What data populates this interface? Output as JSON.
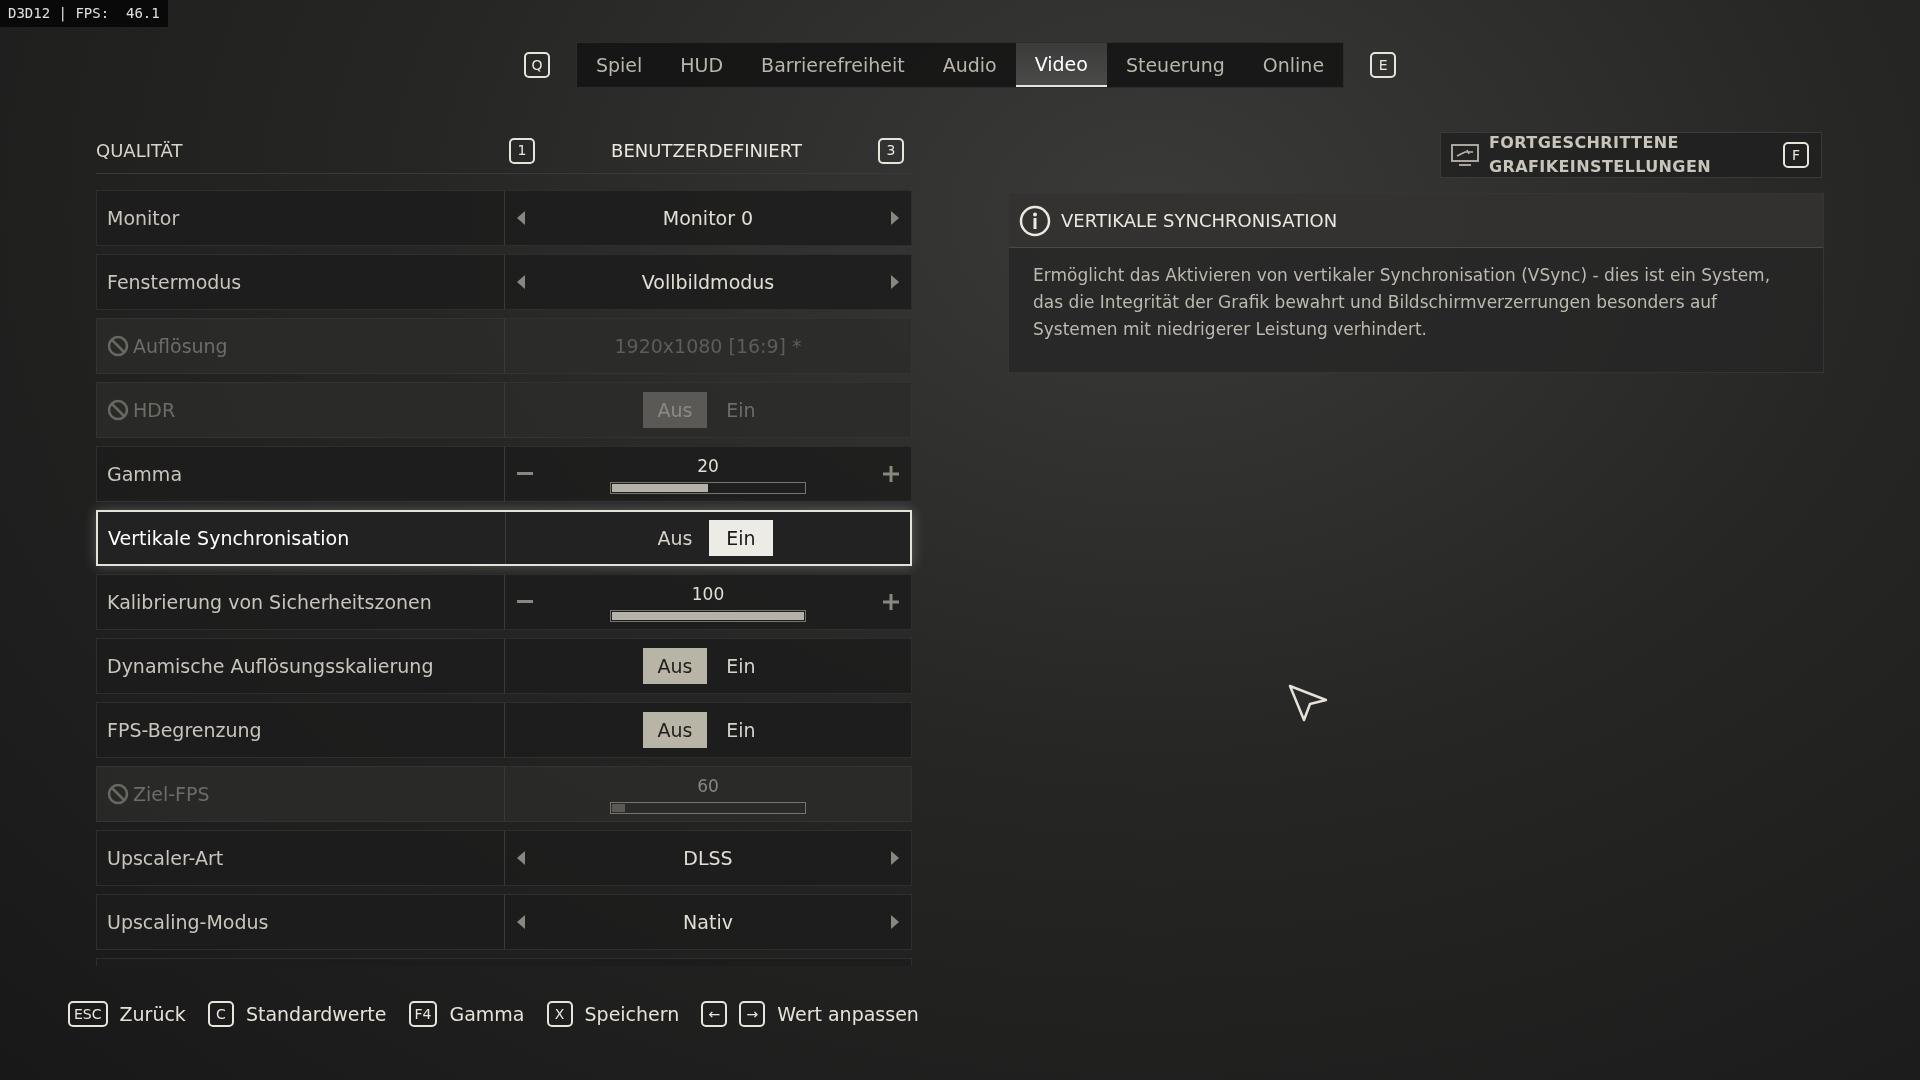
{
  "debug_overlay": "D3D12 | FPS:  46.1",
  "tab_bar": {
    "prev_key": "Q",
    "next_key": "E",
    "tabs": [
      {
        "label": "Spiel",
        "selected": false
      },
      {
        "label": "HUD",
        "selected": false
      },
      {
        "label": "Barrierefreiheit",
        "selected": false
      },
      {
        "label": "Audio",
        "selected": false
      },
      {
        "label": "Video",
        "selected": true
      },
      {
        "label": "Steuerung",
        "selected": false
      },
      {
        "label": "Online",
        "selected": false
      }
    ]
  },
  "quality": {
    "label": "QUALITÄT",
    "prev_key": "1",
    "preset": "BENUTZERDEFINIERT",
    "next_key": "3"
  },
  "settings": [
    {
      "kind": "selector",
      "label": "Monitor",
      "value": "Monitor 0",
      "disabled": false,
      "selected": false
    },
    {
      "kind": "selector",
      "label": "Fenstermodus",
      "value": "Vollbildmodus",
      "disabled": false,
      "selected": false
    },
    {
      "kind": "selector",
      "label": "Auflösung",
      "value": "1920x1080 [16:9] *",
      "disabled": true,
      "selected": false
    },
    {
      "kind": "toggle",
      "label": "HDR",
      "options": [
        {
          "label": "Aus",
          "selected": true
        },
        {
          "label": "Ein",
          "selected": false
        }
      ],
      "disabled": true,
      "selected": false
    },
    {
      "kind": "slider",
      "label": "Gamma",
      "reading": "20",
      "level": 0.5,
      "disabled": false,
      "selected": false
    },
    {
      "kind": "toggle",
      "label": "Vertikale Synchronisation",
      "options": [
        {
          "label": "Aus",
          "selected": false
        },
        {
          "label": "Ein",
          "selected": true
        }
      ],
      "disabled": false,
      "selected": true
    },
    {
      "kind": "slider",
      "label": "Kalibrierung von Sicherheitszonen",
      "reading": "100",
      "level": 1,
      "disabled": false,
      "selected": false
    },
    {
      "kind": "toggle",
      "label": "Dynamische Auflösungsskalierung",
      "options": [
        {
          "label": "Aus",
          "selected": true
        },
        {
          "label": "Ein",
          "selected": false
        }
      ],
      "disabled": false,
      "selected": false
    },
    {
      "kind": "toggle",
      "label": "FPS-Begrenzung",
      "options": [
        {
          "label": "Aus",
          "selected": true
        },
        {
          "label": "Ein",
          "selected": false
        }
      ],
      "disabled": false,
      "selected": false
    },
    {
      "kind": "slider",
      "label": "Ziel-FPS",
      "reading": "60",
      "level": 0.07,
      "disabled": true,
      "selected": false
    },
    {
      "kind": "selector",
      "label": "Upscaler-Art",
      "value": "DLSS",
      "disabled": false,
      "selected": false
    },
    {
      "kind": "selector",
      "label": "Upscaling-Modus",
      "value": "Nativ",
      "disabled": false,
      "selected": false
    }
  ],
  "advanced_button": {
    "label": "FORTGESCHRITTENE GRAFIKEINSTELLUNGEN",
    "key": "F"
  },
  "info_panel": {
    "title": "VERTIKALE SYNCHRONISATION",
    "text": "Ermöglicht das Aktivieren von vertikaler Synchronisation (VSync) - dies ist ein System, das die Integrität der Grafik bewahrt und Bildschirmverzerrungen besonders auf Systemen mit niedrigerer Leistung verhindert."
  },
  "footer_hints": [
    {
      "keys": [
        "ESC"
      ],
      "label": "Zurück"
    },
    {
      "keys": [
        "C"
      ],
      "label": "Standardwerte"
    },
    {
      "keys": [
        "F4"
      ],
      "label": "Gamma"
    },
    {
      "keys": [
        "X"
      ],
      "label": "Speichern"
    },
    {
      "keys": [
        "←",
        "→"
      ],
      "label": "Wert anpassen"
    }
  ]
}
